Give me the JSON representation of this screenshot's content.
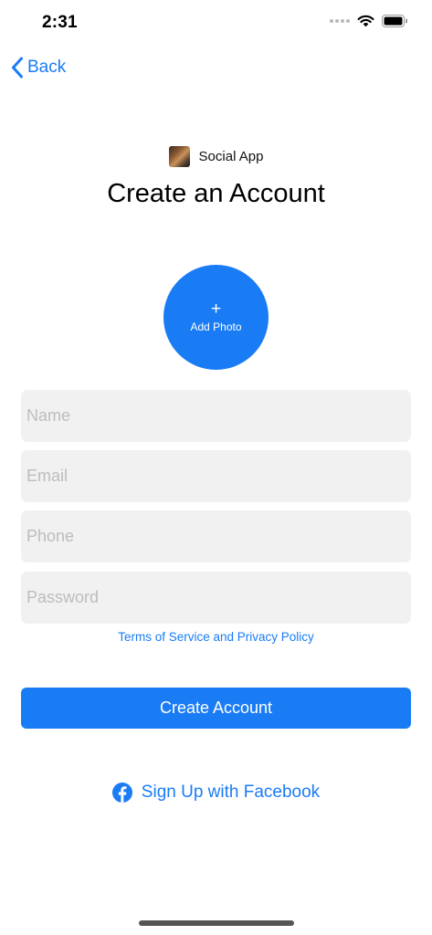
{
  "status_bar": {
    "time": "2:31"
  },
  "nav": {
    "back_label": "Back"
  },
  "brand": {
    "name": "Social App"
  },
  "title": "Create an Account",
  "photo": {
    "plus": "+",
    "label": "Add Photo"
  },
  "form": {
    "name_placeholder": "Name",
    "email_placeholder": "Email",
    "phone_placeholder": "Phone",
    "password_placeholder": "Password"
  },
  "terms_link": "Terms of Service and Privacy Policy",
  "create_button": "Create Account",
  "facebook_button": "Sign Up with Facebook",
  "colors": {
    "accent": "#1a7cf5",
    "field_bg": "#f1f1f1"
  }
}
